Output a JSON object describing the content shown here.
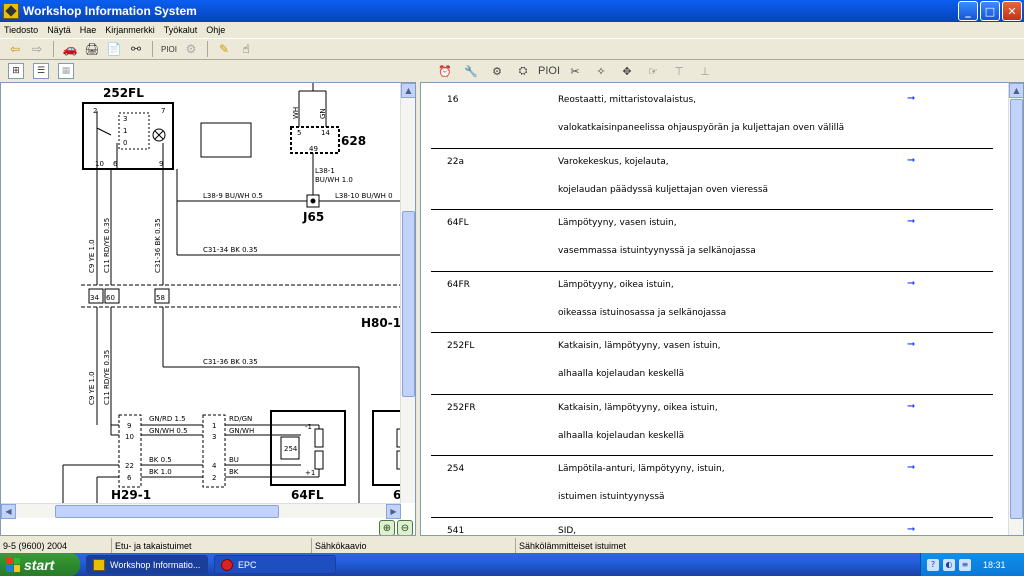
{
  "window": {
    "title": "Workshop Information System"
  },
  "menu": [
    "Tiedosto",
    "Näytä",
    "Hae",
    "Kirjanmerkki",
    "Työkalut",
    "Ohje"
  ],
  "toolbar": {
    "pioi_label": "PIOI"
  },
  "diagram": {
    "labels": {
      "comp_252fl": "252FL",
      "comp_628": "628",
      "comp_j65": "J65",
      "comp_h80": "H80-1",
      "comp_h29": "H29-1",
      "comp_64fl": "64FL",
      "comp_6": "6",
      "comp_254": "254",
      "pin_2": "2",
      "pin_7": "7",
      "pin_10": "10",
      "pin_6": "6",
      "pin_9": "9",
      "pin_3": "3",
      "pin_1": "1",
      "pin_0": "0",
      "pin_5": "5",
      "pin_14": "14",
      "pin_49": "49",
      "pin_34": "34",
      "pin_60": "60",
      "pin_58": "58",
      "wire_wh": "WH",
      "wire_gn": "GN",
      "l38_9": "L38-9  BU/WH 0.5",
      "l38_10": "L38-10  BU/WH 0",
      "l38_1": "L38-1",
      "l38_1_spec": "BU/WH 1.0",
      "c31_34": "C31-34  BK  0.35",
      "c31_36": "C31-36  BK  0.35",
      "v_c9_ye": "C9  YE  1.0",
      "v_c11": "C11  RD/YE 0.35",
      "v_c31_36": "C31-36  BK  0.35",
      "v2_c9_ye": "C9  YE  1.0",
      "v2_c11": "C11  RD/YE 0.35",
      "h29_gnrd": "GN/RD  1.5",
      "h29_gnwh": "GN/WH  0.5",
      "h29_bk05": "BK  0.5",
      "h29_bk10": "BK  1.0",
      "r_rdgn": "RD/GN",
      "r_gnwh": "GN/WH",
      "r_bu": "BU",
      "r_bk": "BK",
      "p_10": "10",
      "p_9": "9",
      "p_22": "22",
      "p_6b": "6",
      "p_3": "3",
      "p_1": "1",
      "p_4": "4",
      "p_2": "2",
      "sw_minus1": "-1",
      "sw_plus1": "+1"
    }
  },
  "components_list": [
    {
      "code": "16",
      "line1": "Reostaatti, mittaristovalaistus,",
      "line2": "valokatkaisinpaneelissa ohjauspyörän ja kuljettajan oven välillä"
    },
    {
      "code": "22a",
      "line1": "Varokekeskus, kojelauta,",
      "line2": "kojelaudan päädyssä kuljettajan oven vieressä"
    },
    {
      "code": "64FL",
      "line1": "Lämpötyyny, vasen istuin,",
      "line2": "vasemmassa istuintyynyssä ja selkänojassa"
    },
    {
      "code": "64FR",
      "line1": "Lämpötyyny, oikea istuin,",
      "line2": "oikeassa istuinosassa ja selkänojassa"
    },
    {
      "code": "252FL",
      "line1": "Katkaisin, lämpötyyny, vasen istuin,",
      "line2": "alhaalla kojelaudan keskellä"
    },
    {
      "code": "252FR",
      "line1": "Katkaisin, lämpötyyny, oikea istuin,",
      "line2": "alhaalla kojelaudan keskellä"
    },
    {
      "code": "254",
      "line1": "Lämpötila-anturi, lämpötyyny, istuin,",
      "line2": "istuimen istuintyynyssä"
    },
    {
      "code": "541",
      "line1": "SID,",
      "line2": ""
    }
  ],
  "status": {
    "model": "9-5 (9600) 2004",
    "section": "Etu- ja takaistuimet",
    "view": "Sähkökaavio",
    "topic": "Sähkölämmitteiset istuimet"
  },
  "taskbar": {
    "start": "start",
    "task1": "Workshop Informatio...",
    "task2": "EPC",
    "clock": "18:31"
  },
  "colors": {
    "link_arrow": "#1a3cff",
    "titlebar": "#0a5ff0",
    "start_green": "#2e8b2e"
  }
}
